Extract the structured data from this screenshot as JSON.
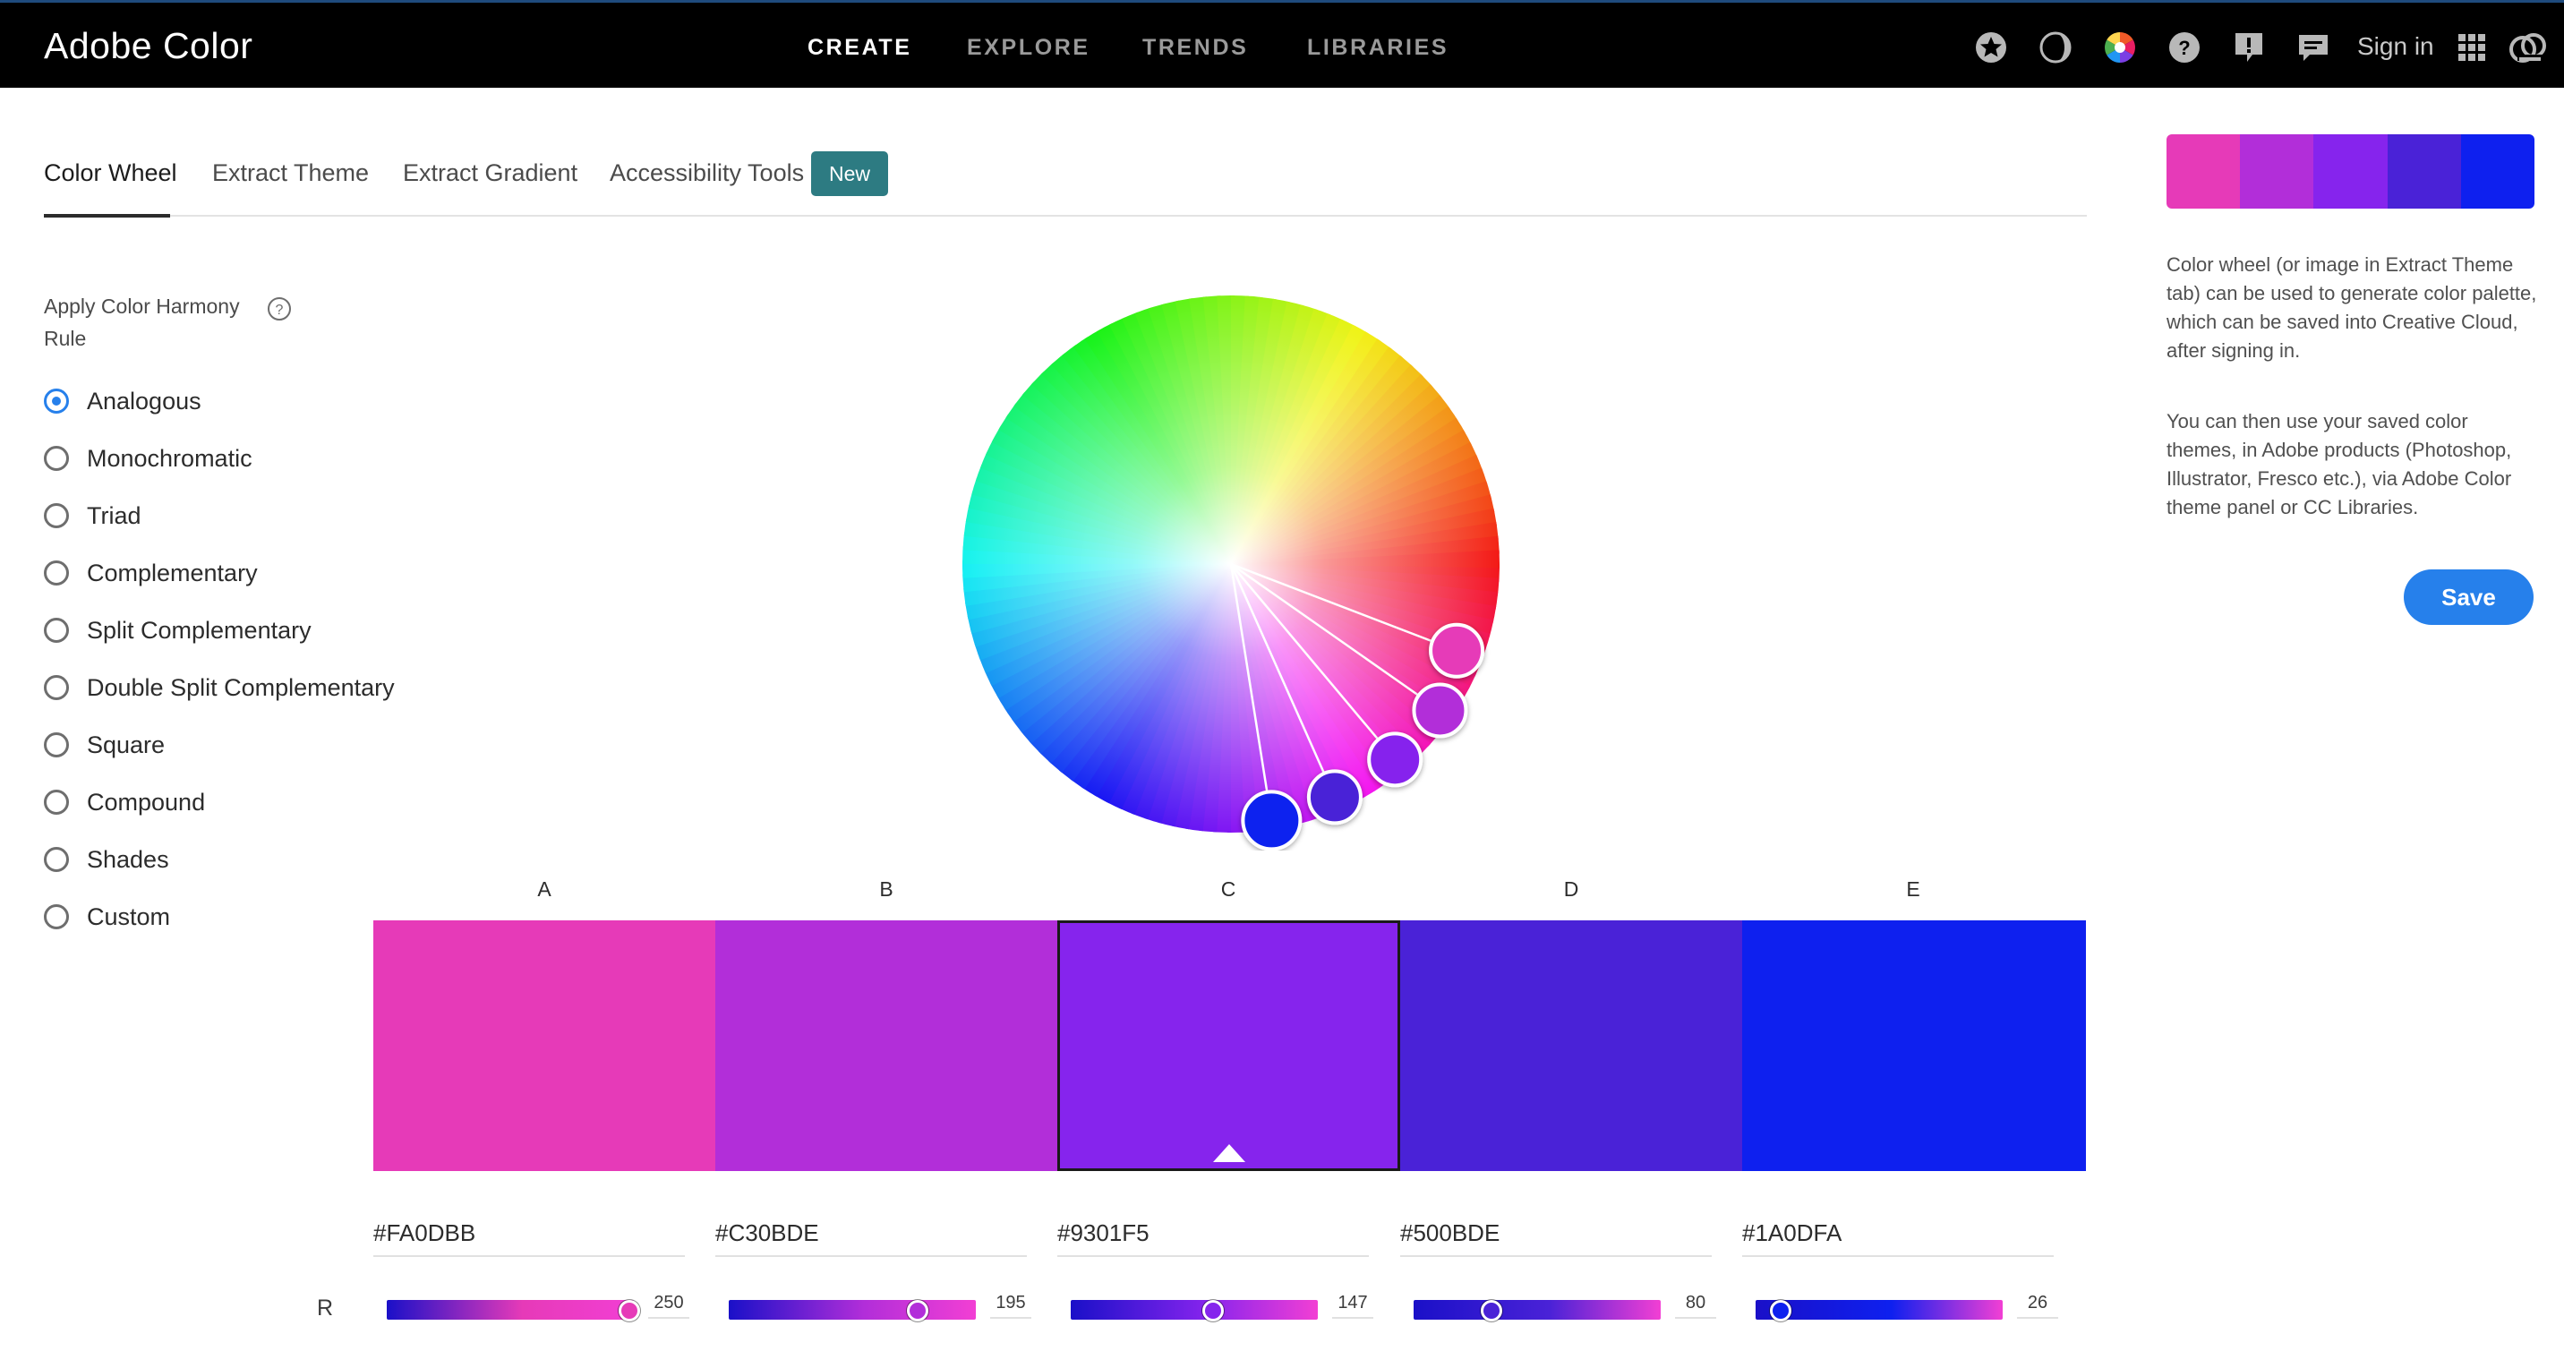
{
  "app": {
    "brand": "Adobe Color"
  },
  "nav": {
    "items": [
      {
        "label": "CREATE",
        "active": true
      },
      {
        "label": "EXPLORE",
        "active": false
      },
      {
        "label": "TRENDS",
        "active": false
      },
      {
        "label": "LIBRARIES",
        "active": false
      }
    ],
    "icons": [
      "favorites-star-icon",
      "contrast-half-moon-icon",
      "color-wheel-icon",
      "help-icon",
      "feedback-alert-icon",
      "chat-icon",
      "app-grid-icon",
      "creative-cloud-icon"
    ],
    "sign_in": "Sign in"
  },
  "tabs": {
    "items": [
      {
        "label": "Color Wheel",
        "active": true
      },
      {
        "label": "Extract Theme",
        "active": false
      },
      {
        "label": "Extract Gradient",
        "active": false
      },
      {
        "label": "Accessibility Tools",
        "active": false
      }
    ],
    "badge": "New"
  },
  "harmony": {
    "title": "Apply Color Harmony Rule",
    "selected": "Analogous",
    "rules": [
      "Analogous",
      "Monochromatic",
      "Triad",
      "Complementary",
      "Split Complementary",
      "Double Split Complementary",
      "Square",
      "Compound",
      "Shades",
      "Custom"
    ]
  },
  "theme": {
    "selected_swatch": "C",
    "swatches": [
      {
        "letter": "A",
        "hex": "#FA0DBB",
        "display": "#e63ab8",
        "r": 250
      },
      {
        "letter": "B",
        "hex": "#C30BDE",
        "display": "#b22ed9",
        "r": 195
      },
      {
        "letter": "C",
        "hex": "#9301F5",
        "display": "#8624ed",
        "r": 147
      },
      {
        "letter": "D",
        "hex": "#500BDE",
        "display": "#4a22d7",
        "r": 80
      },
      {
        "letter": "E",
        "hex": "#1A0DFA",
        "display": "#0e20ef",
        "r": 26
      }
    ],
    "channel_label": "R"
  },
  "side_panel": {
    "info_1": "Color wheel (or image in Extract Theme tab) can be used to generate color palette, which can be saved into Creative Cloud, after signing in.",
    "info_2": "You can then use your saved color themes, in Adobe products (Photoshop, Illustrator, Fresco etc.), via Adobe Color theme panel or CC Libraries.",
    "save": "Save"
  }
}
